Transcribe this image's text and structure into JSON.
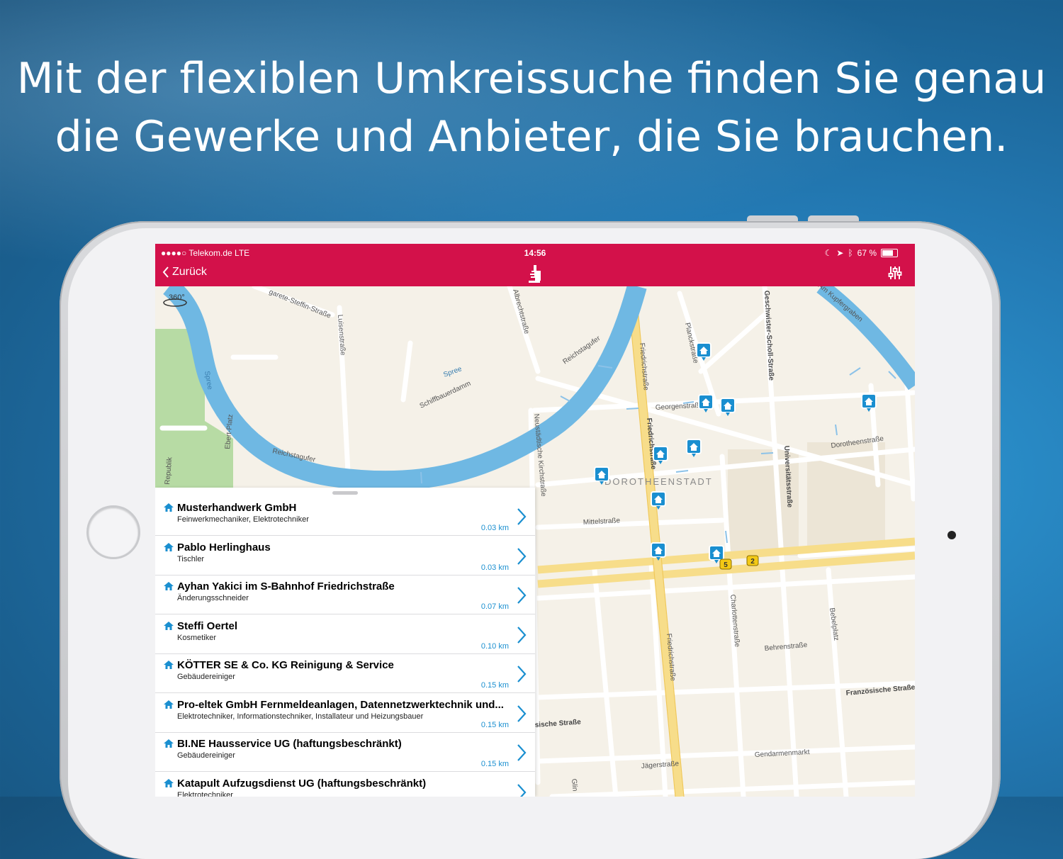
{
  "headline": {
    "line1": "Mit der flexiblen Umkreissuche finden Sie genau",
    "line2": "die Gewerke und Anbieter, die Sie brauchen."
  },
  "status_bar": {
    "carrier": "●●●●○ Telekom.de  LTE",
    "time": "14:56",
    "battery": "67 %",
    "battery_level": 0.67
  },
  "nav": {
    "back_label": "Zurück",
    "logo_icon": "thumbs-up-hand-icon",
    "filter_icon": "sliders-icon"
  },
  "map": {
    "badge": "360°",
    "district": "DOROTHEENSTADT",
    "labels": {
      "spree1": "Spree",
      "spree2": "Spree",
      "luisen": "Luisenstraße",
      "schiff": "Schiffbauerdamm",
      "reichstag1": "Reichstagufer",
      "reichstag2": "Reichstagufer",
      "margarete": "garete-Steffin-Straße",
      "albrecht": "Albrechtstraße",
      "friedrich1": "Friedrichstraße",
      "friedrich2": "Friedrichstraße",
      "friedrich3": "Friedrichstraße",
      "georgen": "Georgenstraße",
      "planck": "Planckstraße",
      "geschwister": "Geschwister-Scholl-Straße",
      "kupfer": "Am Kupfergraben",
      "universitaet": "Universitätsstraße",
      "dorotheen": "Dorotheenstraße",
      "neustaedt": "Neustädtische Kirchstraße",
      "mittel": "Mittelstraße",
      "charlotten": "Charlottenstraße",
      "bebel": "Bebelplatz",
      "behren": "Behrenstraße",
      "franz": "Französische Straße",
      "jaeger": "Jägerstraße",
      "gendarmen": "Gendarmenmarkt",
      "sische": "sische Straße",
      "ebert": "Ebert-Platz",
      "republik": "Republik",
      "glin": "Glin"
    },
    "transit_badges": [
      "5",
      "2"
    ]
  },
  "list": {
    "items": [
      {
        "title": "Musterhandwerk GmbH",
        "subtitle": "Feinwerkmechaniker, Elektrotechniker",
        "distance": "0.03 km"
      },
      {
        "title": "Pablo Herlinghaus",
        "subtitle": "Tischler",
        "distance": "0.03 km"
      },
      {
        "title": "Ayhan Yakici  im S-Bahnhof Friedrichstraße",
        "subtitle": "Änderungsschneider",
        "distance": "0.07 km"
      },
      {
        "title": "Steffi Oertel",
        "subtitle": "Kosmetiker",
        "distance": "0.10 km"
      },
      {
        "title": "KÖTTER SE & Co. KG Reinigung & Service",
        "subtitle": "Gebäudereiniger",
        "distance": "0.15 km"
      },
      {
        "title": "Pro-eltek GmbH Fernmeldeanlagen, Datennetzwerktechnik und...",
        "subtitle": "Elektrotechniker, Informationstechniker, Installateur und Heizungsbauer",
        "distance": "0.15 km"
      },
      {
        "title": "BI.NE Hausservice UG (haftungsbeschränkt)",
        "subtitle": "Gebäudereiniger",
        "distance": "0.15 km"
      },
      {
        "title": "Katapult Aufzugsdienst UG (haftungsbeschränkt)",
        "subtitle": "Elektrotechniker",
        "distance": ""
      }
    ]
  },
  "colors": {
    "brand": "#d3114a",
    "accent": "#1a8fd0",
    "water": "#6fb8e3",
    "park": "#b7dba4",
    "land": "#f5f1e8"
  }
}
